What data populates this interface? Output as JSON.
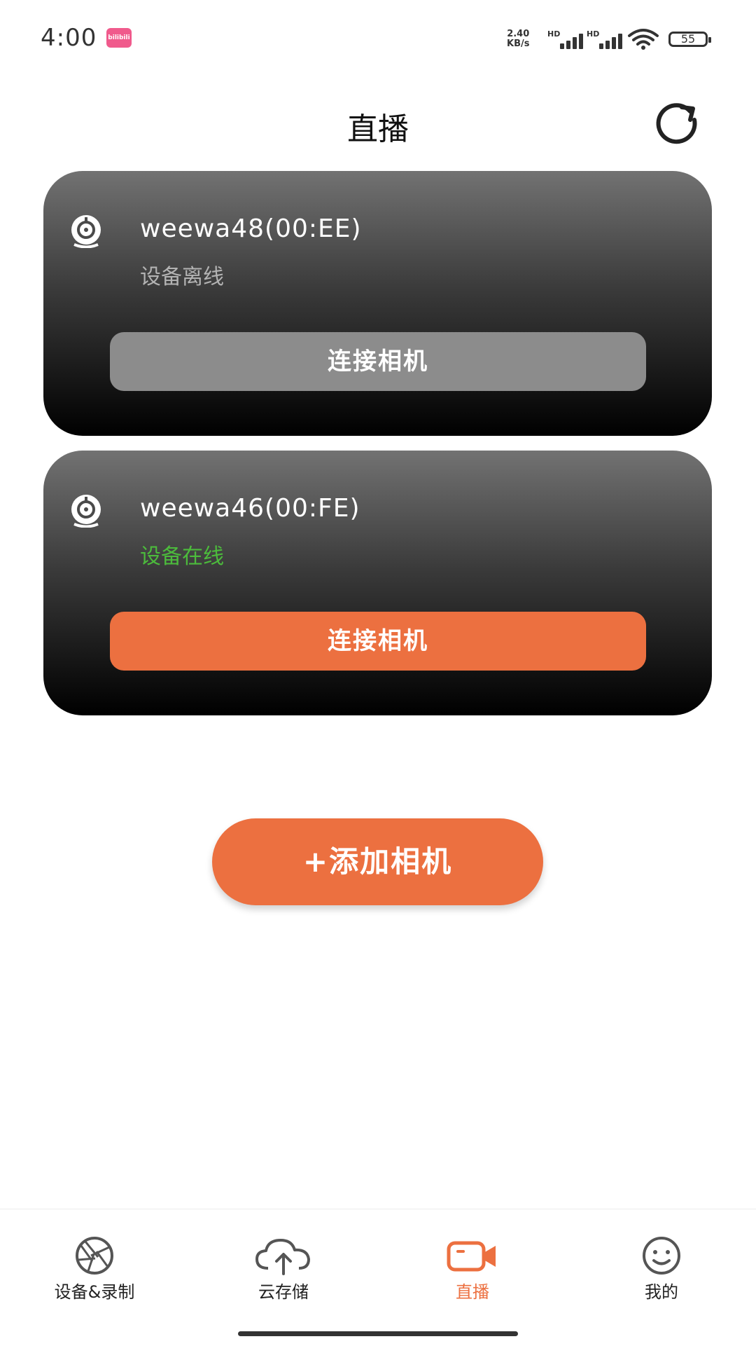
{
  "status_bar": {
    "time": "4:00",
    "app_badge": "bilibili",
    "net_speed_value": "2.40",
    "net_speed_unit": "KB/s",
    "hd_label": "HD",
    "battery": "55"
  },
  "header": {
    "title": "直播",
    "refresh_icon": "refresh-icon"
  },
  "devices": [
    {
      "name": "weewa48(00:EE)",
      "status": "设备离线",
      "online": false,
      "connect_label": "连接相机",
      "icon": "camera-icon"
    },
    {
      "name": "weewa46(00:FE)",
      "status": "设备在线",
      "online": true,
      "connect_label": "连接相机",
      "icon": "camera-icon"
    }
  ],
  "add_camera_label": "+添加相机",
  "bottom_nav": {
    "items": [
      {
        "label": "设备&录制",
        "icon": "aperture-icon",
        "active": false
      },
      {
        "label": "云存储",
        "icon": "cloud-upload-icon",
        "active": false
      },
      {
        "label": "直播",
        "icon": "video-camera-icon",
        "active": true
      },
      {
        "label": "我的",
        "icon": "smiley-icon",
        "active": false
      }
    ]
  },
  "colors": {
    "accent": "#ec7040",
    "online": "#4cbb3c",
    "offline_text": "#b3b3b3",
    "disabled_button": "#8c8c8c"
  }
}
